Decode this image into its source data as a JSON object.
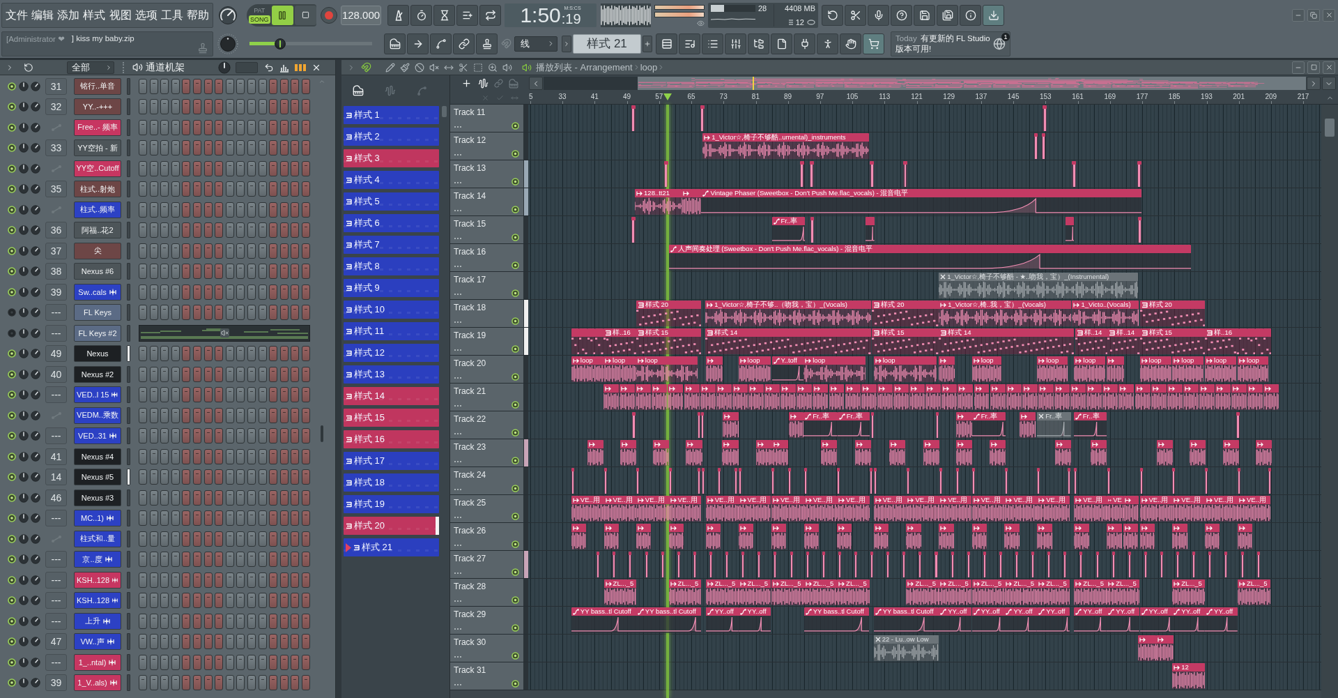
{
  "toolbar": {
    "menu": [
      "文件",
      "编辑",
      "添加",
      "样式",
      "视图",
      "选项",
      "工具",
      "帮助"
    ],
    "hint": {
      "user": "[Administrator ❤",
      "message": "] kiss my baby.zip"
    },
    "modes": [
      {
        "label": "PAT",
        "selected": false
      },
      {
        "label": "SONG",
        "selected": true
      }
    ],
    "playing": true,
    "tempo": "128.000",
    "time": {
      "main": "1:50",
      "fraction": ":19",
      "format": "M:S:CS"
    },
    "peak_meter": [
      {
        "level": 1
      },
      {
        "level": 1
      }
    ],
    "monitor": {
      "cpu": "28",
      "level": 0.3,
      "memory": "4408 MB",
      "polyphony": "12"
    },
    "master": {
      "level": 0.25
    },
    "snap": "线",
    "pattern": "样式 21",
    "news": {
      "day": "Today",
      "text": "有更新的 FL Studio 版本可用!",
      "badge": "1"
    }
  },
  "channel_rack": {
    "filter": "全部",
    "title": "通道机架",
    "channels": [
      {
        "kind": "instrument",
        "number": "31",
        "name": "铭行..单音",
        "color": "#6d4646",
        "enabled": true,
        "selected": false
      },
      {
        "kind": "instrument",
        "number": "32",
        "name": "YY..-+++",
        "color": "#6d4646",
        "enabled": true,
        "selected": false
      },
      {
        "kind": "automation",
        "name": "Free..- 频率",
        "color": "#c73661",
        "enabled": true,
        "selected": false
      },
      {
        "kind": "instrument",
        "number": "33",
        "name": "YY空拍 - 新",
        "color": "#4d5559",
        "enabled": true,
        "selected": false
      },
      {
        "kind": "automation",
        "name": "YY空..Cutoff",
        "color": "#c73661",
        "enabled": true,
        "selected": false
      },
      {
        "kind": "instrument",
        "number": "35",
        "name": "柱式..射炮",
        "color": "#6d4646",
        "enabled": true,
        "selected": false
      },
      {
        "kind": "automation",
        "name": "柱式..频率",
        "color": "#2c41c4",
        "enabled": true,
        "selected": false
      },
      {
        "kind": "instrument",
        "number": "36",
        "name": "阿福..花2",
        "color": "#4d5559",
        "enabled": true,
        "selected": false
      },
      {
        "kind": "instrument",
        "number": "37",
        "name": "尖",
        "color": "#6d4646",
        "enabled": true,
        "selected": false
      },
      {
        "kind": "instrument",
        "number": "38",
        "name": "Nexus #6",
        "color": "#4d5559",
        "enabled": true,
        "selected": false
      },
      {
        "kind": "audio",
        "number": "39",
        "name": "Sw..cals",
        "color": "#2c41c4",
        "enabled": true,
        "selected": false
      },
      {
        "kind": "instrument",
        "number": "---",
        "name": "FL Keys",
        "color": "#5b6b85",
        "enabled": false,
        "selected": false
      },
      {
        "kind": "piano_roll",
        "number": "---",
        "name": "FL Keys #2",
        "color": "#5b6b85",
        "enabled": false,
        "selected": false
      },
      {
        "kind": "instrument",
        "number": "49",
        "name": "Nexus",
        "color": "#1d2023",
        "enabled": true,
        "selected": true
      },
      {
        "kind": "instrument",
        "number": "40",
        "name": "Nexus #2",
        "color": "#1d2023",
        "enabled": true,
        "selected": false
      },
      {
        "kind": "audio",
        "number": "---",
        "name": "VED..l 15",
        "color": "#2c41c4",
        "enabled": true,
        "selected": false
      },
      {
        "kind": "automation",
        "name": "VEDM..乘数",
        "color": "#2c41c4",
        "enabled": true,
        "selected": false
      },
      {
        "kind": "audio",
        "number": "---",
        "name": "VED..31",
        "color": "#2c41c4",
        "enabled": true,
        "selected": false
      },
      {
        "kind": "instrument",
        "number": "41",
        "name": "Nexus #4",
        "color": "#1d2023",
        "enabled": true,
        "selected": false
      },
      {
        "kind": "instrument",
        "number": "14",
        "name": "Nexus #5",
        "color": "#1d2023",
        "enabled": true,
        "selected": true
      },
      {
        "kind": "instrument",
        "number": "46",
        "name": "Nexus #3",
        "color": "#1d2023",
        "enabled": true,
        "selected": false
      },
      {
        "kind": "audio",
        "number": "---",
        "name": "MC..1)",
        "color": "#2c41c4",
        "enabled": true,
        "selected": false
      },
      {
        "kind": "automation",
        "name": "柱式和..量",
        "color": "#2c41c4",
        "enabled": true,
        "selected": false
      },
      {
        "kind": "audio",
        "number": "---",
        "name": "京..度",
        "color": "#2c41c4",
        "enabled": true,
        "selected": false
      },
      {
        "kind": "audio",
        "number": "---",
        "name": "KSH..128",
        "color": "#c73661",
        "enabled": true,
        "selected": false
      },
      {
        "kind": "audio",
        "number": "---",
        "name": "KSH..128",
        "color": "#2c41c4",
        "enabled": true,
        "selected": false
      },
      {
        "kind": "audio",
        "number": "---",
        "name": "上升",
        "color": "#2c41c4",
        "enabled": true,
        "selected": false
      },
      {
        "kind": "audio",
        "number": "47",
        "name": "VW..声",
        "color": "#2c41c4",
        "enabled": true,
        "selected": false
      },
      {
        "kind": "audio",
        "number": "---",
        "name": "1_..ntal)",
        "color": "#c73661",
        "enabled": true,
        "selected": false
      },
      {
        "kind": "audio",
        "number": "39",
        "name": "1_V..als)",
        "color": "#c73661",
        "enabled": true,
        "selected": false
      }
    ]
  },
  "playlist": {
    "title": "播放列表 - Arrangement",
    "path": [
      "loop"
    ],
    "patterns": [
      {
        "label": "样式 1",
        "color": "#2b3fbf",
        "selected": false,
        "highlighted": false
      },
      {
        "label": "样式 2",
        "color": "#2b3fbf",
        "selected": false,
        "highlighted": false
      },
      {
        "label": "样式 3",
        "color": "#c0365f",
        "selected": false,
        "highlighted": false
      },
      {
        "label": "样式 4",
        "color": "#2b3fbf",
        "selected": false,
        "highlighted": false
      },
      {
        "label": "样式 5",
        "color": "#2b3fbf",
        "selected": false,
        "highlighted": false
      },
      {
        "label": "样式 6",
        "color": "#2b3fbf",
        "selected": false,
        "highlighted": false
      },
      {
        "label": "样式 7",
        "color": "#2b3fbf",
        "selected": false,
        "highlighted": false
      },
      {
        "label": "样式 8",
        "color": "#2b3fbf",
        "selected": false,
        "highlighted": false
      },
      {
        "label": "样式 9",
        "color": "#2b3fbf",
        "selected": false,
        "highlighted": false
      },
      {
        "label": "样式 10",
        "color": "#2b3fbf",
        "selected": false,
        "highlighted": false
      },
      {
        "label": "样式 11",
        "color": "#2b3fbf",
        "selected": false,
        "highlighted": false
      },
      {
        "label": "样式 12",
        "color": "#2b3fbf",
        "selected": false,
        "highlighted": false
      },
      {
        "label": "样式 13",
        "color": "#2b3fbf",
        "selected": false,
        "highlighted": false
      },
      {
        "label": "样式 14",
        "color": "#c0365f",
        "selected": false,
        "highlighted": false
      },
      {
        "label": "样式 15",
        "color": "#c0365f",
        "selected": false,
        "highlighted": false
      },
      {
        "label": "样式 16",
        "color": "#c0365f",
        "selected": false,
        "highlighted": false
      },
      {
        "label": "样式 17",
        "color": "#2b3fbf",
        "selected": false,
        "highlighted": false
      },
      {
        "label": "样式 18",
        "color": "#2b3fbf",
        "selected": false,
        "highlighted": false
      },
      {
        "label": "样式 19",
        "color": "#2b3fbf",
        "selected": false,
        "highlighted": false
      },
      {
        "label": "样式 20",
        "color": "#c0365f",
        "selected": false,
        "highlighted": true
      },
      {
        "label": "样式 21",
        "color": "#2b3fbf",
        "selected": true,
        "highlighted": false
      }
    ],
    "ruler": [
      "5",
      "33",
      "41",
      "49",
      "57",
      "65",
      "73",
      "81",
      "89",
      "97",
      "105",
      "113",
      "121",
      "129",
      "137",
      "145",
      "153",
      "161",
      "169",
      "177",
      "185",
      "193",
      "201",
      "209",
      "217"
    ],
    "tracks": [
      {
        "name": "Track 11",
        "enabled": true
      },
      {
        "name": "Track 12",
        "enabled": true,
        "clips": [
          {
            "kind": "audio",
            "label": "1_Victor☆,椅子不够酷..umental)_instruments",
            "muted": false
          }
        ]
      },
      {
        "name": "Track 13",
        "enabled": true,
        "color": "#9aa9b5"
      },
      {
        "name": "Track 14",
        "enabled": true,
        "color": "#9aa9b5",
        "clips": [
          {
            "kind": "audio",
            "label": "128..tt21",
            "muted": false
          },
          {
            "kind": "automation",
            "label": "Vintage Phaser (Sweetbox - Don't Push Me.flac_vocals) - 混音电平",
            "muted": false
          }
        ]
      },
      {
        "name": "Track 15",
        "enabled": true,
        "clips": [
          {
            "kind": "automation",
            "label": "Fr..率",
            "muted": false
          }
        ]
      },
      {
        "name": "Track 16",
        "enabled": true,
        "clips": [
          {
            "kind": "automation",
            "label": "人声间奏处理 (Sweetbox - Don't Push Me.flac_vocals) - 混音电平",
            "muted": false
          }
        ]
      },
      {
        "name": "Track 17",
        "enabled": true,
        "clips": [
          {
            "kind": "audio",
            "label": "1_Victor☆,椅子不够酷 - ★..吻我，宝）_(Instrumental)",
            "muted": true
          }
        ]
      },
      {
        "name": "Track 18",
        "enabled": true,
        "color": "#f0f0f0",
        "clips": [
          {
            "kind": "pattern",
            "label": "样式 20",
            "muted": false
          },
          {
            "kind": "audio",
            "label": "1_Victor☆,椅子不够..（吻我，宝）_(Vocals)",
            "muted": false
          },
          {
            "kind": "pattern",
            "label": "样式 20",
            "muted": false
          },
          {
            "kind": "audio",
            "label": "1_Victor☆,椅..我，宝）_(Vocals)",
            "muted": false
          },
          {
            "kind": "audio",
            "label": "1_Victo..(Vocals)",
            "muted": false
          },
          {
            "kind": "pattern",
            "label": "样式 20",
            "muted": false
          }
        ]
      },
      {
        "name": "Track 19",
        "enabled": true,
        "color": "#f0f0f0",
        "clips": [
          {
            "kind": "pattern",
            "label": "样..16",
            "muted": false
          },
          {
            "kind": "pattern",
            "label": "样式 15",
            "muted": false
          },
          {
            "kind": "pattern",
            "label": "样式 14",
            "muted": false
          },
          {
            "kind": "pattern",
            "label": "样式 15",
            "muted": false
          },
          {
            "kind": "pattern",
            "label": "样式 14",
            "muted": false
          },
          {
            "kind": "pattern",
            "label": "样..14",
            "muted": false
          },
          {
            "kind": "pattern",
            "label": "样..14",
            "muted": false
          },
          {
            "kind": "pattern",
            "label": "样式 15",
            "muted": false
          },
          {
            "kind": "pattern",
            "label": "样..16",
            "muted": false
          }
        ]
      },
      {
        "name": "Track 20",
        "enabled": true,
        "clips": [
          {
            "kind": "audio",
            "label": "loop",
            "muted": false
          },
          {
            "kind": "audio",
            "label": "loop",
            "muted": false
          },
          {
            "kind": "audio",
            "label": "loop",
            "muted": false
          },
          {
            "kind": "audio",
            "label": "loop",
            "muted": false
          },
          {
            "kind": "automation",
            "label": "Y..toff",
            "muted": false
          },
          {
            "kind": "audio",
            "label": "loop",
            "muted": false
          },
          {
            "kind": "audio",
            "label": "loop",
            "muted": false
          },
          {
            "kind": "audio",
            "label": "loop",
            "muted": false
          },
          {
            "kind": "audio",
            "label": "loop",
            "muted": false
          },
          {
            "kind": "audio",
            "label": "loop",
            "muted": false
          },
          {
            "kind": "audio",
            "label": "loop",
            "muted": false
          },
          {
            "kind": "audio",
            "label": "loop",
            "muted": false
          },
          {
            "kind": "audio",
            "label": "loop",
            "muted": false
          },
          {
            "kind": "audio",
            "label": "loop",
            "muted": false
          }
        ]
      },
      {
        "name": "Track 21",
        "enabled": true
      },
      {
        "name": "Track 22",
        "enabled": true,
        "clips": [
          {
            "kind": "automation",
            "label": "Fr..率",
            "muted": false
          },
          {
            "kind": "automation",
            "label": "Fr..率",
            "muted": false
          },
          {
            "kind": "automation",
            "label": "Fr..率",
            "muted": false
          },
          {
            "kind": "automation",
            "label": "Fr..率",
            "muted": true
          },
          {
            "kind": "automation",
            "label": "Fr..率",
            "muted": false
          }
        ]
      },
      {
        "name": "Track 23",
        "enabled": true,
        "color": "#c8a5b8"
      },
      {
        "name": "Track 24",
        "enabled": true
      },
      {
        "name": "Track 25",
        "enabled": true,
        "clips": [
          {
            "kind": "audio",
            "label": "VE..用",
            "muted": false
          },
          {
            "kind": "audio",
            "label": "VE..用",
            "muted": false
          },
          {
            "kind": "audio",
            "label": "VE..用",
            "muted": false
          },
          {
            "kind": "audio",
            "label": "VE..用",
            "muted": false
          },
          {
            "kind": "audio",
            "label": "VE..用",
            "muted": false
          },
          {
            "kind": "audio",
            "label": "VE..用",
            "muted": false
          },
          {
            "kind": "audio",
            "label": "VE..用",
            "muted": false
          },
          {
            "kind": "audio",
            "label": "VE..用",
            "muted": false
          },
          {
            "kind": "audio",
            "label": "VE..用",
            "muted": false
          },
          {
            "kind": "audio",
            "label": "VE..用",
            "muted": false
          },
          {
            "kind": "audio",
            "label": "VE..用",
            "muted": false
          },
          {
            "kind": "audio",
            "label": "VE..用",
            "muted": false
          },
          {
            "kind": "audio",
            "label": "VE..用",
            "muted": false
          },
          {
            "kind": "audio",
            "label": "VE..用",
            "muted": false
          },
          {
            "kind": "audio",
            "label": "VE..用",
            "muted": false
          },
          {
            "kind": "audio",
            "label": "VE..用",
            "muted": false
          },
          {
            "kind": "audio",
            "label": "VE",
            "muted": false
          },
          {
            "kind": "audio",
            "label": "VE..用",
            "muted": false
          },
          {
            "kind": "audio",
            "label": "VE..用",
            "muted": false
          },
          {
            "kind": "audio",
            "label": "VE..用",
            "muted": false
          },
          {
            "kind": "audio",
            "label": "VE..用",
            "muted": false
          }
        ]
      },
      {
        "name": "Track 26",
        "enabled": true
      },
      {
        "name": "Track 27",
        "enabled": true,
        "color": "#c8a5b8"
      },
      {
        "name": "Track 28",
        "enabled": true,
        "clips": [
          {
            "kind": "audio",
            "label": "ZL..._5",
            "muted": false
          },
          {
            "kind": "audio",
            "label": "ZL..._5",
            "muted": false
          },
          {
            "kind": "audio",
            "label": "ZL..._5",
            "muted": false
          },
          {
            "kind": "audio",
            "label": "ZL..._5",
            "muted": false
          },
          {
            "kind": "audio",
            "label": "ZL..._5",
            "muted": false
          },
          {
            "kind": "audio",
            "label": "ZL..._5",
            "muted": false
          },
          {
            "kind": "audio",
            "label": "ZL..._5",
            "muted": false
          },
          {
            "kind": "audio",
            "label": "ZL..._5",
            "muted": false
          },
          {
            "kind": "audio",
            "label": "ZL..._5",
            "muted": false
          },
          {
            "kind": "audio",
            "label": "ZL..._5",
            "muted": false
          },
          {
            "kind": "audio",
            "label": "ZL..._5",
            "muted": false
          },
          {
            "kind": "audio",
            "label": "ZL..._5",
            "muted": false
          },
          {
            "kind": "audio",
            "label": "ZL..._5",
            "muted": false
          },
          {
            "kind": "audio",
            "label": "ZL..._5",
            "muted": false
          },
          {
            "kind": "audio",
            "label": "ZL..._5",
            "muted": false
          },
          {
            "kind": "audio",
            "label": "ZL..._5",
            "muted": false
          }
        ]
      },
      {
        "name": "Track 29",
        "enabled": true,
        "clips": [
          {
            "kind": "automation",
            "label": "YY bass..tl Cutoff",
            "muted": false
          },
          {
            "kind": "automation",
            "label": "YY bass..tl Cutoff",
            "muted": false
          },
          {
            "kind": "automation",
            "label": "YY..off",
            "muted": false
          },
          {
            "kind": "automation",
            "label": "YY..off",
            "muted": false
          },
          {
            "kind": "automation",
            "label": "YY bass..tl Cutoff",
            "muted": false
          },
          {
            "kind": "automation",
            "label": "YY bass..tl Cutoff",
            "muted": false
          },
          {
            "kind": "automation",
            "label": "YY..off",
            "muted": false
          },
          {
            "kind": "automation",
            "label": "YY..off",
            "muted": false
          },
          {
            "kind": "automation",
            "label": "YY..off",
            "muted": false
          },
          {
            "kind": "automation",
            "label": "YY..off",
            "muted": false
          },
          {
            "kind": "automation",
            "label": "YY..off",
            "muted": false
          },
          {
            "kind": "automation",
            "label": "YY..off",
            "muted": false
          },
          {
            "kind": "automation",
            "label": "YY..off",
            "muted": false
          },
          {
            "kind": "automation",
            "label": "YY..off",
            "muted": false
          },
          {
            "kind": "automation",
            "label": "YY..off",
            "muted": false
          }
        ]
      },
      {
        "name": "Track 30",
        "enabled": true,
        "clips": [
          {
            "kind": "audio",
            "label": "22 - Lu..ow Low",
            "muted": true
          }
        ]
      },
      {
        "name": "Track 31",
        "enabled": true,
        "clips": [
          {
            "kind": "audio",
            "label": "12",
            "muted": false
          }
        ]
      }
    ]
  }
}
